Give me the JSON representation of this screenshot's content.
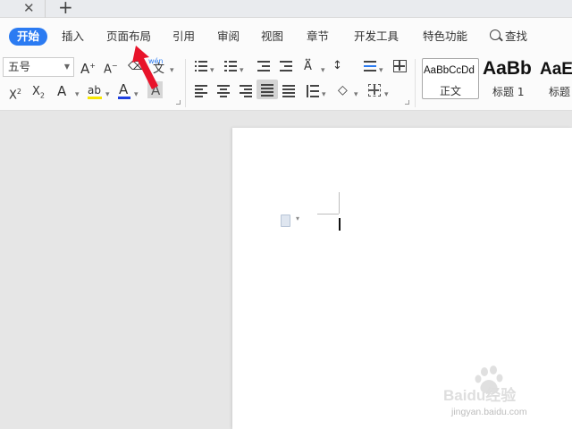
{
  "tabbar": {
    "close": "✕",
    "new_tab": "+"
  },
  "menu": {
    "items": [
      "开始",
      "插入",
      "页面布局",
      "引用",
      "审阅",
      "视图",
      "章节",
      "开发工具",
      "特色功能"
    ],
    "search": "查找"
  },
  "ribbon": {
    "font_size": "五号",
    "phonetic": "wén",
    "phonetic_char": "文",
    "styles": [
      {
        "preview": "AaBbCcDd",
        "caption": "正文"
      },
      {
        "preview": "AaBb",
        "caption": "标题 1"
      },
      {
        "preview": "AaE",
        "caption": "标题"
      }
    ]
  },
  "colors": {
    "accent": "#2b7bf2",
    "annotation": "#e8132a",
    "highlight": "#f7e600",
    "font_color": "#1e3fe0"
  },
  "watermark": {
    "brand": "Baidu经验",
    "url": "jingyan.baidu.com"
  }
}
